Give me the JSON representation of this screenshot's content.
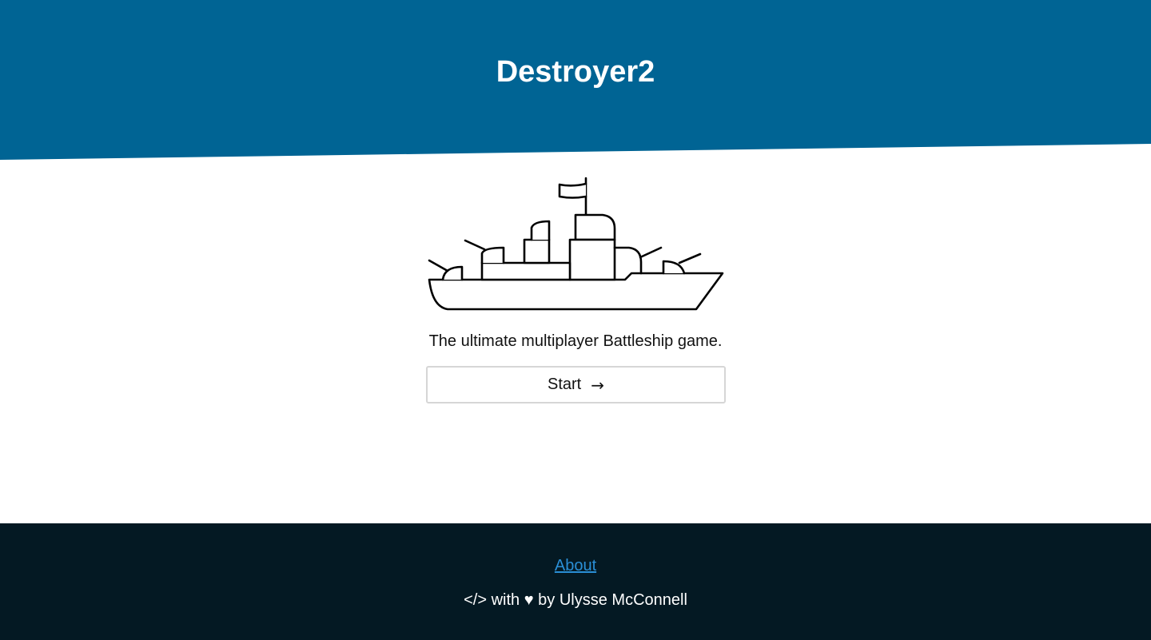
{
  "header": {
    "title": "Destroyer2",
    "background_color": "#006494"
  },
  "hero": {
    "illustration": "battleship-icon",
    "tagline": "The ultimate multiplayer Battleship game.",
    "start_label": "Start",
    "start_arrow": "→"
  },
  "footer": {
    "background_color": "#041923",
    "about_link": "About",
    "credit_code": "</>",
    "credit_with": "with",
    "credit_heart": "♥",
    "credit_by": "by Ulysse McConnell"
  }
}
